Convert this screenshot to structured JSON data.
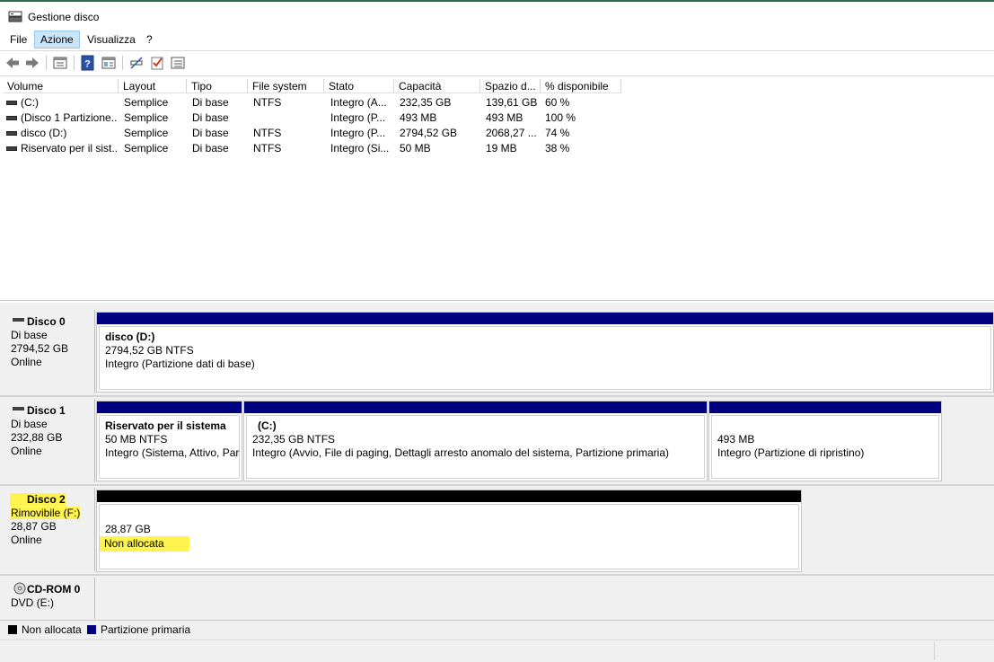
{
  "window": {
    "title": "Gestione disco",
    "title_icon": "disk-management-icon"
  },
  "menu": {
    "items": [
      "File",
      "Azione",
      "Visualizza",
      "?"
    ],
    "active_index": 1
  },
  "toolbar": {
    "icons": [
      "back-arrow-icon",
      "forward-arrow-icon",
      "properties-list-icon",
      "help-icon",
      "view-pane-icon",
      "connect-icon",
      "check-icon",
      "list-view-icon"
    ]
  },
  "volume_list": {
    "columns": [
      "Volume",
      "Layout",
      "Tipo",
      "File system",
      "Stato",
      "Capacità",
      "Spazio d...",
      "% disponibile"
    ],
    "rows": [
      [
        "(C:)",
        "Semplice",
        "Di base",
        "NTFS",
        "Integro (A...",
        "232,35 GB",
        "139,61 GB",
        "60 %"
      ],
      [
        "(Disco 1 Partizione...",
        "Semplice",
        "Di base",
        "",
        "Integro (P...",
        "493 MB",
        "493 MB",
        "100 %"
      ],
      [
        "disco (D:)",
        "Semplice",
        "Di base",
        "NTFS",
        "Integro (P...",
        "2794,52 GB",
        "2068,27 ...",
        "74 %"
      ],
      [
        "Riservato per il sist...",
        "Semplice",
        "Di base",
        "NTFS",
        "Integro (Si...",
        "50 MB",
        "19 MB",
        "38 %"
      ]
    ]
  },
  "disks": [
    {
      "name": "Disco 0",
      "lines": [
        "Di base",
        "2794,52 GB",
        "Online"
      ],
      "partitions": [
        {
          "title": "disco  (D:)",
          "size": "2794,52 GB NTFS",
          "status": "Integro (Partizione dati di base)"
        }
      ]
    },
    {
      "name": "Disco 1",
      "lines": [
        "Di base",
        "232,88 GB",
        "Online"
      ],
      "partitions": [
        {
          "title": "Riservato per il sistema",
          "size": "50 MB NTFS",
          "status": "Integro (Sistema, Attivo, Par"
        },
        {
          "title": "(C:)",
          "size": "232,35 GB NTFS",
          "status": "Integro (Avvio, File di paging, Dettagli arresto anomalo del sistema, Partizione primaria)"
        },
        {
          "title": "",
          "size": "493 MB",
          "status": "Integro (Partizione di ripristino)"
        }
      ]
    },
    {
      "name": "Disco 2",
      "lines": [
        "Rimovibile (F:)",
        "28,87 GB",
        "Online"
      ],
      "partitions": [
        {
          "title": "",
          "size": "28,87 GB",
          "status": "Non allocata"
        }
      ]
    },
    {
      "name": "CD-ROM 0",
      "lines": [
        "DVD (E:)"
      ],
      "partitions": []
    }
  ],
  "legend": [
    {
      "label": "Non allocata",
      "color": "#000000"
    },
    {
      "label": "Partizione primaria",
      "color": "#000080"
    }
  ],
  "colors": {
    "primary_partition": "#000080",
    "unallocated": "#000000",
    "highlight": "#fff44f"
  }
}
